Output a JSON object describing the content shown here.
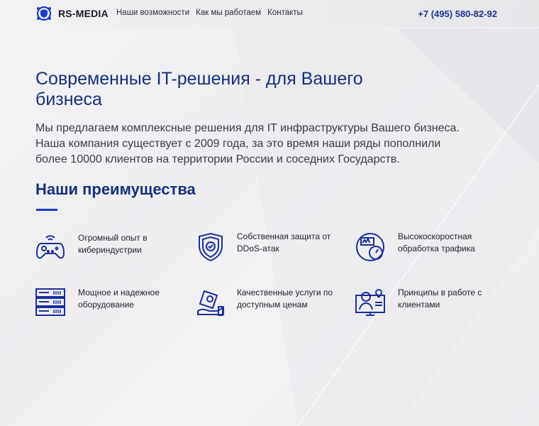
{
  "header": {
    "brand": "RS-MEDIA",
    "nav": [
      "Наши возможности",
      "Как мы работаем",
      "Контакты"
    ],
    "phone": "+7 (495) 580-82-92"
  },
  "hero": {
    "title": "Современные IT-решения - для Вашего бизнеса",
    "text": "Мы предлагаем комплексные решения для IT инфраструктуры Вашего бизнеса. Наша компания существует с 2009 года, за это время наши ряды пополнили более 10000 клиентов на территории России и соседних Государств."
  },
  "advantages": {
    "title": "Наши преимущества",
    "items": [
      {
        "label": "Огромный опыт в кибериндустрии",
        "icon": "gamepad-icon"
      },
      {
        "label": "Собственная защита от DDoS-атак",
        "icon": "shield-icon"
      },
      {
        "label": "Высокоскоростная обработка трафика",
        "icon": "speedometer-icon"
      },
      {
        "label": "Мощное и надежное оборудование",
        "icon": "server-icon"
      },
      {
        "label": "Качественные услуги по доступным ценам",
        "icon": "price-tag-hand-icon"
      },
      {
        "label": "Принципы в работе с клиентами",
        "icon": "support-agent-icon"
      }
    ]
  },
  "colors": {
    "primary": "#14307c",
    "icon": "#1a2f9a",
    "accent": "#1d3ec9"
  }
}
